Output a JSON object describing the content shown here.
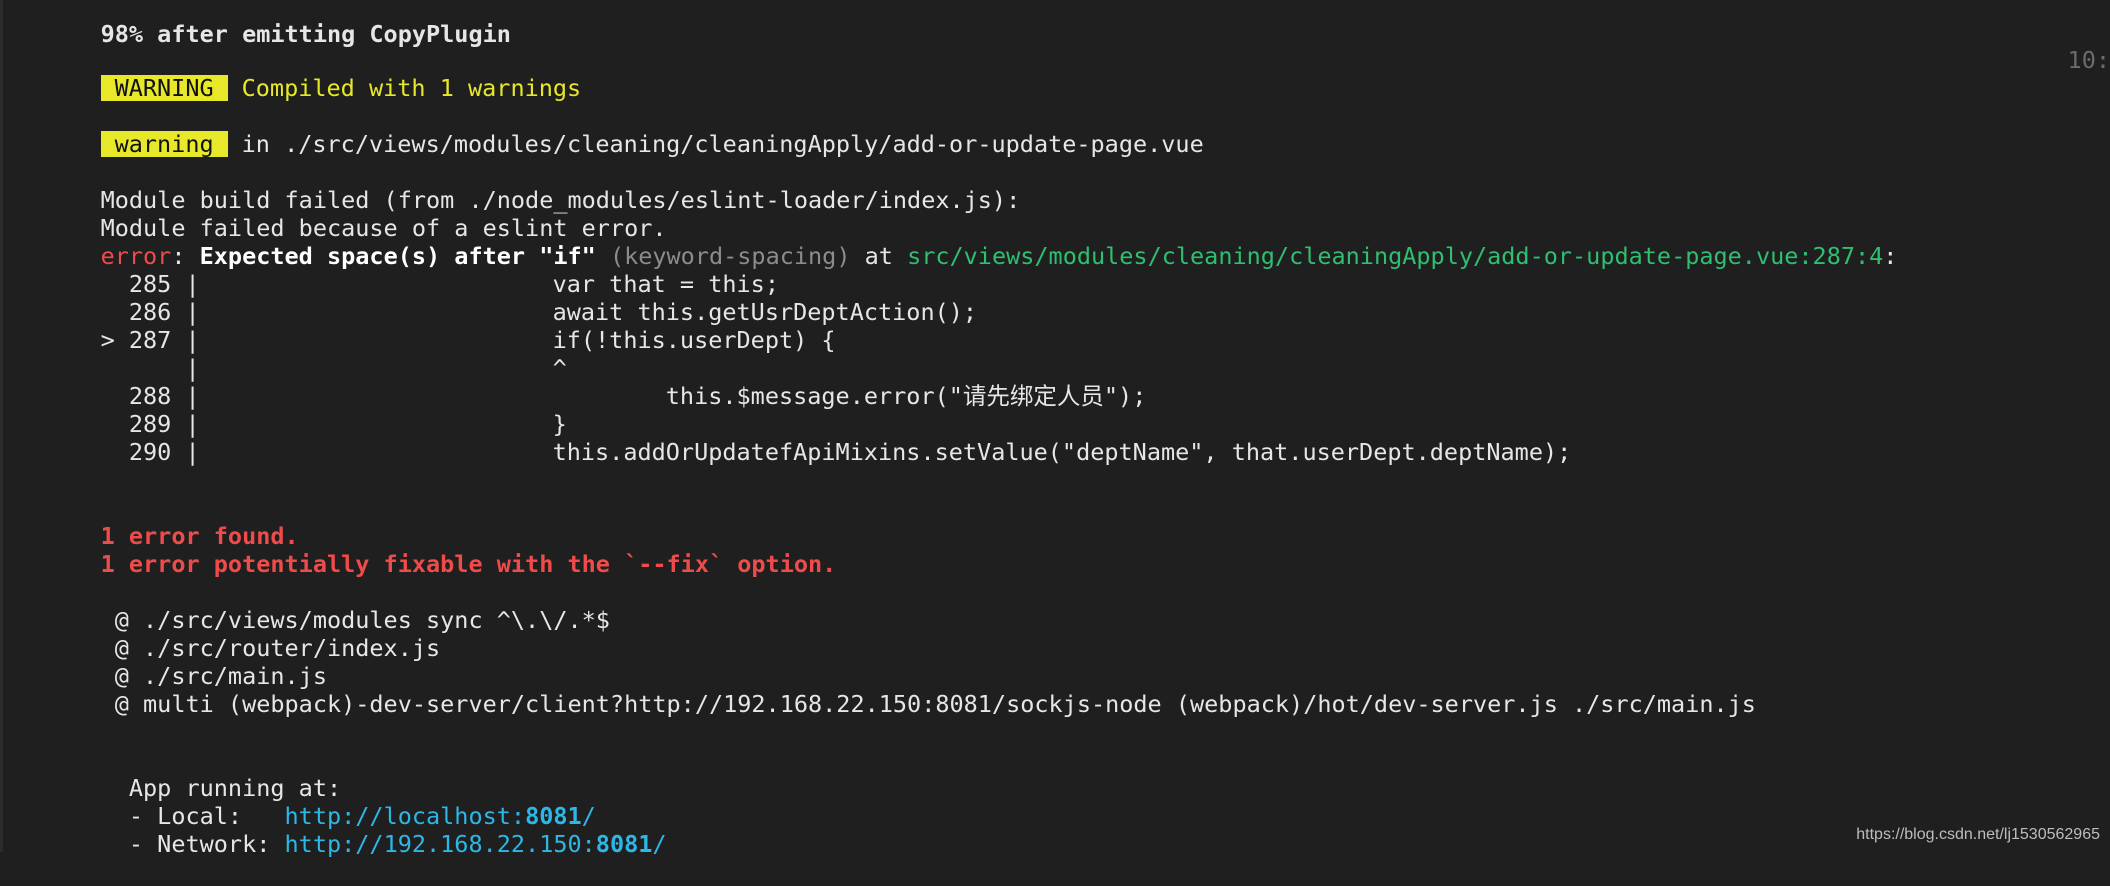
{
  "terminal": {
    "header_line": "98% after emitting CopyPlugin",
    "warning_badge": "WARNING",
    "warning_text": "Compiled with 1 warnings",
    "timestamp": "10:",
    "file_badge": "warning",
    "file_text": "in ./src/views/modules/cleaning/cleaningApply/add-or-update-page.vue",
    "module_failed_1": "Module build failed (from ./node_modules/eslint-loader/index.js):",
    "module_failed_2": "Module failed because of a eslint error.",
    "error_label": "error",
    "error_colon": ": ",
    "error_message": "Expected space(s) after \"if\"",
    "error_rule": " (keyword-spacing)",
    "error_at": " at ",
    "error_location": "src/views/modules/cleaning/cleaningApply/add-or-update-page.vue:287:4",
    "error_end_colon": ":",
    "code_lines": [
      {
        "gutter": "  285 |",
        "code": "var that = this;"
      },
      {
        "gutter": "  286 |",
        "code": "await this.getUsrDeptAction();"
      },
      {
        "gutter": "> 287 |",
        "code": "if(!this.userDept) {"
      },
      {
        "gutter": "      |",
        "code": "^"
      },
      {
        "gutter": "  288 |",
        "code": "        this.$message.error(\"请先绑定人员\");"
      },
      {
        "gutter": "  289 |",
        "code": "}"
      },
      {
        "gutter": "  290 |",
        "code": "this.addOrUpdatefApiMixins.setValue(\"deptName\", that.userDept.deptName);"
      }
    ],
    "summary_1": "1 error found.",
    "summary_2": "1 error potentially fixable with the `--fix` option.",
    "trace": [
      " @ ./src/views/modules sync ^\\.\\/.*$",
      " @ ./src/router/index.js",
      " @ ./src/main.js",
      " @ multi (webpack)-dev-server/client?http://192.168.22.150:8081/sockjs-node (webpack)/hot/dev-server.js ./src/main.js"
    ],
    "app_running": "  App running at:",
    "local_label": "  - Local:   ",
    "local_url_prefix": "http://localhost:",
    "local_port": "8081",
    "local_url_suffix": "/",
    "network_label": "  - Network: ",
    "network_url_prefix": "http://192.168.22.150:",
    "network_port": "8081",
    "network_url_suffix": "/"
  },
  "watermark": "https://blog.csdn.net/lj1530562965",
  "colors": {
    "background": "#1f1f1f",
    "badge_yellow": "#e8e82a",
    "error_red": "#ef4b4b",
    "path_green": "#2fbf71",
    "url_cyan": "#2db7e6"
  }
}
